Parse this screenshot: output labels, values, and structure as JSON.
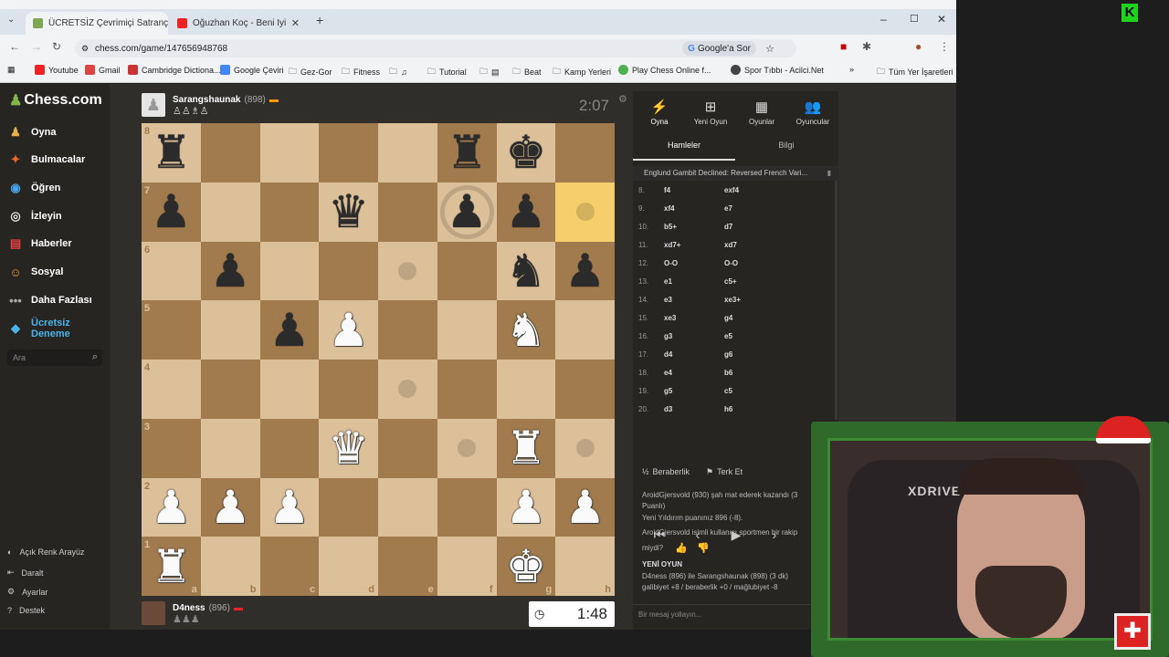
{
  "browser": {
    "tabs": [
      {
        "title": "ÜCRETSİZ Çevrimiçi Satranç Oy",
        "active": true
      },
      {
        "title": "Oğuzhan Koç - Beni İyi Sanı",
        "active": false
      }
    ],
    "url": "chess.com/game/147656948768",
    "google_btn": "Google'a Sor",
    "bookmarks": [
      "Youtube",
      "Gmail",
      "Cambridge Dictiona...",
      "Google Çeviri",
      "Gez-Gor",
      "Fitness",
      "Tutorial",
      "Beat",
      "Kamp Yerleri",
      "Play Chess Online f...",
      "Spor Tıbbı - Acilci.Net"
    ],
    "all_bookmarks": "Tüm Yer İşaretleri"
  },
  "sidebar": {
    "logo": "Chess.com",
    "items": [
      "Oyna",
      "Bulmacalar",
      "Öğren",
      "İzleyin",
      "Haberler",
      "Sosyal",
      "Daha Fazlası",
      "Ücretsiz Deneme"
    ],
    "search_placeholder": "Ara",
    "footer": [
      "Açık Renk Arayüz",
      "Daralt",
      "Ayarlar",
      "Destek"
    ]
  },
  "top_player": {
    "name": "Sarangshaunak",
    "rating": "(898)",
    "clock": "2:07"
  },
  "bottom_player": {
    "name": "D4ness",
    "rating": "(896)",
    "clock": "1:48"
  },
  "board": {
    "ranks": [
      "8",
      "7",
      "6",
      "5",
      "4",
      "3",
      "2",
      "1"
    ],
    "files": [
      "a",
      "b",
      "c",
      "d",
      "e",
      "f",
      "g",
      "h"
    ],
    "rows": [
      [
        "br",
        "",
        "",
        "",
        "",
        "br",
        "bk",
        ""
      ],
      [
        "bp",
        "",
        "",
        "bq",
        "",
        "bp",
        "bp",
        ""
      ],
      [
        "",
        "bp",
        "",
        "",
        "",
        "",
        "bn",
        "bp"
      ],
      [
        "",
        "",
        "bp",
        "wp",
        "",
        "",
        "wn",
        ""
      ],
      [
        "",
        "",
        "",
        "",
        "",
        "",
        "",
        ""
      ],
      [
        "",
        "",
        "",
        "wq",
        "",
        "",
        "wr",
        ""
      ],
      [
        "wp",
        "wp",
        "wp",
        "",
        "",
        "",
        "wp",
        "wp"
      ],
      [
        "wr",
        "",
        "",
        "",
        "",
        "",
        "wk",
        ""
      ]
    ],
    "highlights": [
      "h7"
    ],
    "dots": [
      "h7",
      "e6",
      "e4",
      "f3",
      "h3"
    ],
    "rings": [
      "f7"
    ]
  },
  "panel": {
    "top_tabs": [
      "Oyna",
      "Yeni Oyun",
      "Oyunlar",
      "Oyuncular"
    ],
    "sub_tabs": [
      "Hamleler",
      "Bilgi"
    ],
    "opening": "Englund Gambit Declined: Reversed French Vari...",
    "moves": [
      {
        "n": "8.",
        "w": "f4",
        "b": "exf4"
      },
      {
        "n": "9.",
        "w": "xf4",
        "b": "e7"
      },
      {
        "n": "10.",
        "w": "b5+",
        "b": "d7"
      },
      {
        "n": "11.",
        "w": "xd7+",
        "b": "xd7"
      },
      {
        "n": "12.",
        "w": "O-O",
        "b": "O-O"
      },
      {
        "n": "13.",
        "w": "e1",
        "b": "c5+"
      },
      {
        "n": "14.",
        "w": "e3",
        "b": "xe3+"
      },
      {
        "n": "15.",
        "w": "xe3",
        "b": "g4"
      },
      {
        "n": "16.",
        "w": "g3",
        "b": "e5"
      },
      {
        "n": "17.",
        "w": "d4",
        "b": "g6"
      },
      {
        "n": "18.",
        "w": "e4",
        "b": "b6"
      },
      {
        "n": "19.",
        "w": "g5",
        "b": "c5"
      },
      {
        "n": "20.",
        "w": "d3",
        "b": "h6"
      }
    ],
    "draw": "Beraberlik",
    "resign": "Terk Et",
    "chat_lines": [
      "AroidGjersvold (930) şah mat ederek kazandı (3",
      "Puanlı)",
      "Yeni Yıldırım puanınız 896 (-8).",
      "AroidGjersvold isimli kullanıcı sportmen bir rakip",
      "miydi?",
      "YENİ OYUN",
      "D4ness (896) ile Sarangshaunak (898) (3 dk)",
      "galibiyet +8 / beraberlik +0 / mağlubiyet -8"
    ],
    "chat_placeholder": "Bir mesaj yollayın..."
  },
  "webcam": {
    "label": "XDRIVE"
  }
}
